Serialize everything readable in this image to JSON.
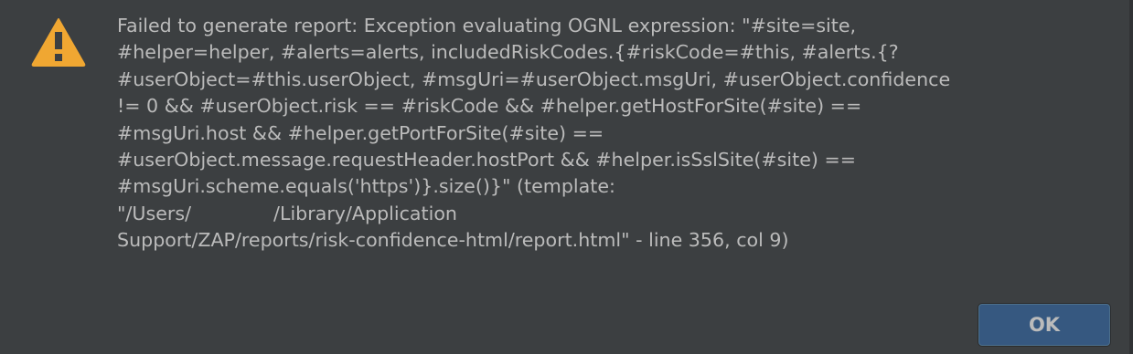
{
  "dialog": {
    "icon": "warning-triangle-icon",
    "icon_color": "#f0a732",
    "message_lines": [
      "Failed to generate report: Exception evaluating OGNL expression: \"#site=site,",
      "#helper=helper, #alerts=alerts, includedRiskCodes.{#riskCode=#this, #alerts.{?",
      "#userObject=#this.userObject, #msgUri=#userObject.msgUri, #userObject.confidence",
      "!= 0 && #userObject.risk == #riskCode && #helper.getHostForSite(#site) ==",
      "#msgUri.host && #helper.getPortForSite(#site) ==",
      "#userObject.message.requestHeader.hostPort && #helper.isSslSite(#site) ==",
      "#msgUri.scheme.equals('https')}.size()}\" (template:",
      "\"/Users/",
      "/Library/Application",
      "Support/ZAP/reports/risk-confidence-html/report.html\" - line 356, col 9)"
    ],
    "ok_label": "OK"
  },
  "colors": {
    "background": "#3c3f41",
    "text": "#bbbbbb",
    "button": "#365880"
  }
}
